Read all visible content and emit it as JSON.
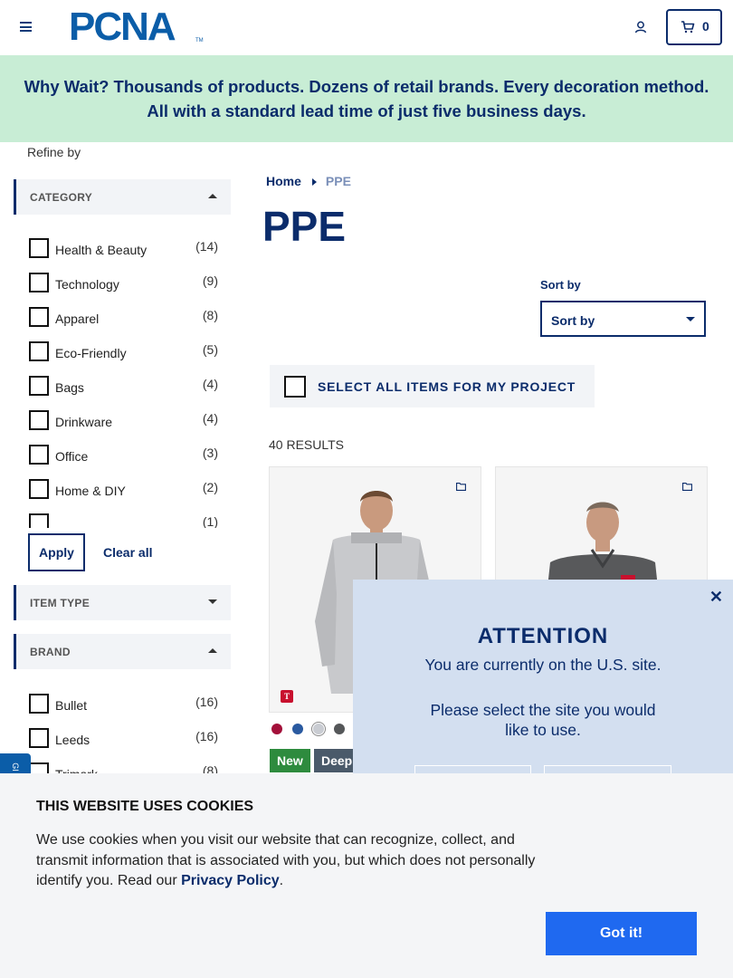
{
  "header": {
    "logo_text": "PCNA",
    "logo_tm": "TM",
    "cart_count": "0"
  },
  "banner": {
    "text": "Why Wait? Thousands of products. Dozens of retail brands. Every decoration method. All with a standard lead time of just five business days."
  },
  "sidebar": {
    "refine_label": "Refine by",
    "category": {
      "title": "CATEGORY",
      "options": [
        {
          "label": "Health & Beauty",
          "count": "(14)"
        },
        {
          "label": "Technology",
          "count": "(9)"
        },
        {
          "label": "Apparel",
          "count": "(8)"
        },
        {
          "label": "Eco-Friendly",
          "count": "(5)"
        },
        {
          "label": "Bags",
          "count": "(4)"
        },
        {
          "label": "Drinkware",
          "count": "(4)"
        },
        {
          "label": "Office",
          "count": "(3)"
        },
        {
          "label": "Home & DIY",
          "count": "(2)"
        },
        {
          "label": "",
          "count": "(1)"
        }
      ]
    },
    "apply_label": "Apply",
    "clear_label": "Clear all",
    "item_type": {
      "title": "ITEM TYPE"
    },
    "brand": {
      "title": "BRAND",
      "options": [
        {
          "label": "Bullet",
          "count": "(16)"
        },
        {
          "label": "Leeds",
          "count": "(16)"
        },
        {
          "label": "Trimark",
          "count": "(8)"
        }
      ]
    }
  },
  "main": {
    "breadcrumb": {
      "home": "Home",
      "current": "PPE"
    },
    "title": "PPE",
    "sort": {
      "label": "Sort by",
      "value": "Sort by"
    },
    "select_all": "SELECT ALL ITEMS FOR MY PROJECT",
    "results": "40 RESULTS",
    "card1": {
      "brand_badge": "T",
      "swatches": [
        "#a3103a",
        "#2a5aa0",
        "#c9ccd2",
        "#555759"
      ],
      "tags": [
        "New",
        "Deep"
      ]
    }
  },
  "modal": {
    "title": "ATTENTION",
    "line1": "You are currently on the U.S. site.",
    "line2": "Please select the site you would like to use."
  },
  "side_tab": {
    "text": "GI"
  },
  "cookie": {
    "title": "THIS WEBSITE USES COOKIES",
    "body": "We use cookies when you visit our website that can recognize, collect, and transmit information that is associated with you, but which does not personally identify you. Read our",
    "link": "Privacy Policy",
    "period": ".",
    "button": "Got it!"
  },
  "colors": {
    "brand_navy": "#0b2c6b",
    "banner_bg": "#c8edd5",
    "modal_bg": "#d3dff0",
    "cookie_button": "#1f69f0",
    "tag_new": "#2e8b3e",
    "tag_deep": "#4a5a6a"
  }
}
